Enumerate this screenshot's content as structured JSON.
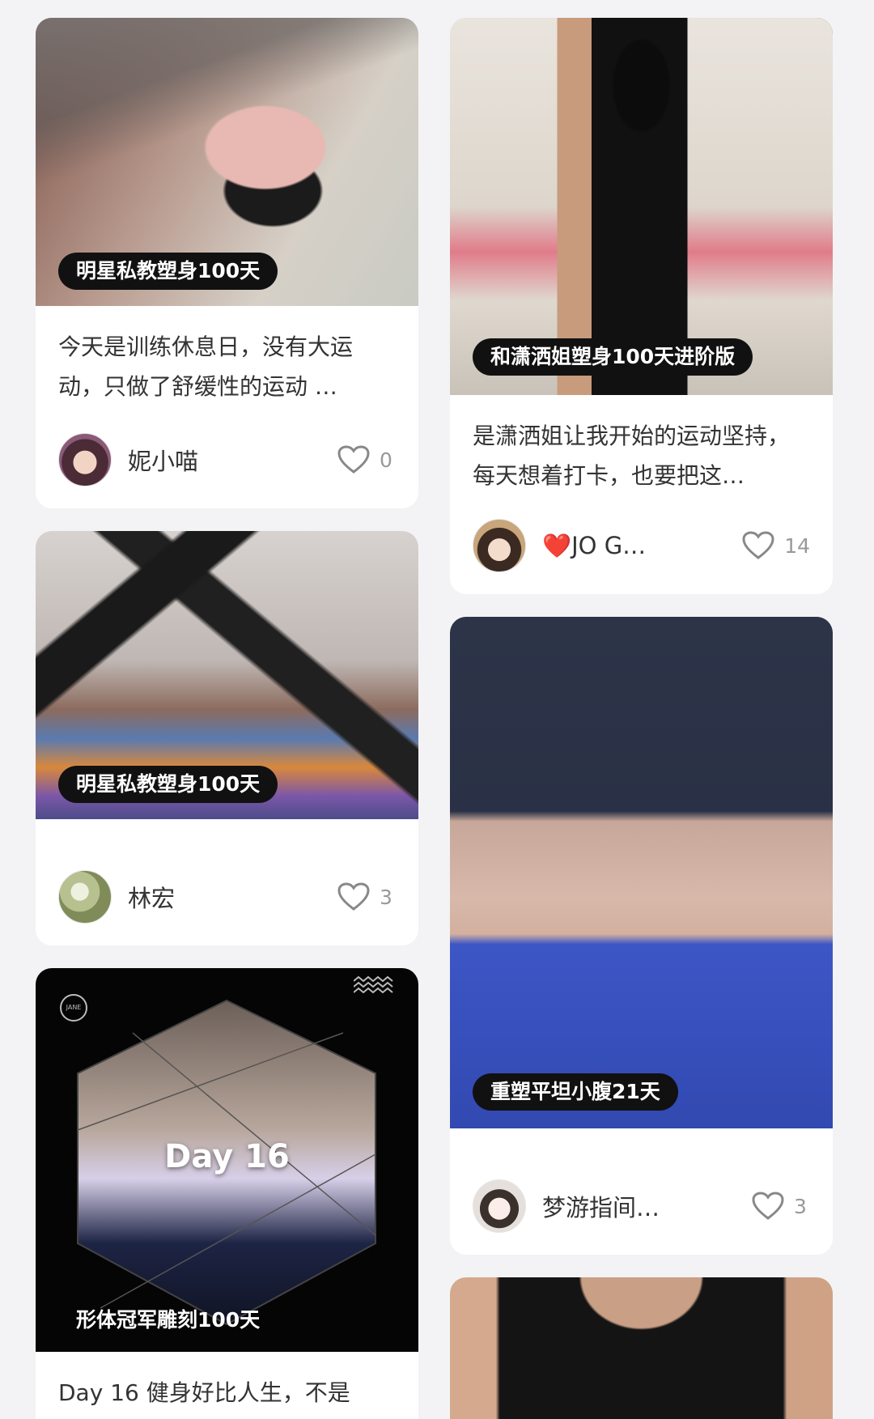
{
  "cards": [
    {
      "tag": "明星私教塑身100天",
      "description": "今天是训练休息日，没有大运动，只做了舒缓性的运动 …",
      "author": "妮小喵",
      "likes": "0"
    },
    {
      "tag": "和潇洒姐塑身100天进阶版",
      "description": "是潇洒姐让我开始的运动坚持，每天想着打卡，也要把这…",
      "author_heart": "❤️",
      "author": "JO G…",
      "likes": "14"
    },
    {
      "tag": "明星私教塑身100天",
      "author": "林宏",
      "likes": "3"
    },
    {
      "tag": "重塑平坦小腹21天",
      "author": "梦游指间…",
      "likes": "3"
    },
    {
      "tag": "形体冠军雕刻100天",
      "overlay_title": "Day 16",
      "watermark": "JANE",
      "description": "Day 16 健身好比人生，不是"
    }
  ],
  "icons": {
    "like": "heart-outline-icon",
    "wave": "wave-pattern-icon"
  },
  "colors": {
    "background": "#f3f3f5",
    "tag_background": "#111111",
    "like_count": "#999999"
  }
}
